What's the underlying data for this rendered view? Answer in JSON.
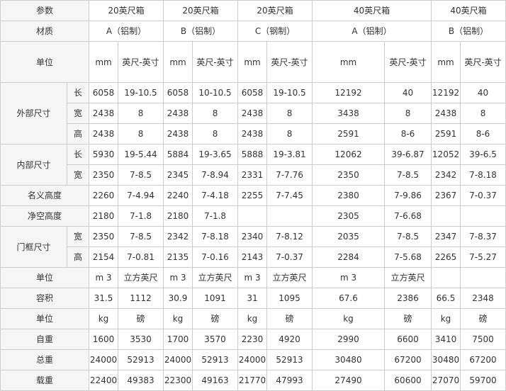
{
  "table": {
    "rows": [
      {
        "key": "param",
        "cells": [
          {
            "text": "参数",
            "cs": 2,
            "lbl": true
          },
          {
            "text": "20英尺箱",
            "cs": 2
          },
          {
            "text": "20英尺箱",
            "cs": 2
          },
          {
            "text": "20英尺箱",
            "cs": 2
          },
          {
            "text": "40英尺箱",
            "cs": 2
          },
          {
            "text": "40英尺箱",
            "cs": 2
          }
        ]
      },
      {
        "key": "material",
        "cells": [
          {
            "text": "材质",
            "cs": 2,
            "lbl": true
          },
          {
            "text": "A（铝制）",
            "cs": 2
          },
          {
            "text": "B（铝制）",
            "cs": 2
          },
          {
            "text": "C（钢制）",
            "cs": 2
          },
          {
            "text": "A（铝制）",
            "cs": 2
          },
          {
            "text": "B（铝制）",
            "cs": 2
          }
        ]
      },
      {
        "key": "unit-1",
        "tall": true,
        "cells": [
          {
            "text": "单位",
            "cs": 2,
            "lbl": true
          },
          {
            "text": "mm"
          },
          {
            "text": "英尺-英寸"
          },
          {
            "text": "mm"
          },
          {
            "text": "英尺-英寸"
          },
          {
            "text": "mm"
          },
          {
            "text": "英尺-英寸"
          },
          {
            "text": "mm"
          },
          {
            "text": "英尺-英寸"
          },
          {
            "text": "mm"
          },
          {
            "text": "英尺-英寸"
          }
        ]
      },
      {
        "key": "ext-length",
        "cells": [
          {
            "text": "外部尺寸",
            "rs": 3,
            "lbl": true
          },
          {
            "text": "长",
            "lbl": true
          },
          {
            "text": "6058"
          },
          {
            "text": "19-10.5"
          },
          {
            "text": "6058"
          },
          {
            "text": "10-10.5"
          },
          {
            "text": "6058"
          },
          {
            "text": "19-10.5"
          },
          {
            "text": "12192"
          },
          {
            "text": "40"
          },
          {
            "text": "12192"
          },
          {
            "text": "40"
          }
        ]
      },
      {
        "key": "ext-width",
        "cells": [
          {
            "text": "宽",
            "lbl": true
          },
          {
            "text": "2438"
          },
          {
            "text": "8"
          },
          {
            "text": "2438"
          },
          {
            "text": "8"
          },
          {
            "text": "2438"
          },
          {
            "text": "8"
          },
          {
            "text": "3438"
          },
          {
            "text": "8"
          },
          {
            "text": "2438"
          },
          {
            "text": "8"
          }
        ]
      },
      {
        "key": "ext-height",
        "cells": [
          {
            "text": "高",
            "lbl": true
          },
          {
            "text": "2438"
          },
          {
            "text": "8"
          },
          {
            "text": "2438"
          },
          {
            "text": "8"
          },
          {
            "text": "2438"
          },
          {
            "text": "8"
          },
          {
            "text": "2591"
          },
          {
            "text": "8-6"
          },
          {
            "text": "2591"
          },
          {
            "text": "8-6"
          }
        ]
      },
      {
        "key": "int-length",
        "cells": [
          {
            "text": "内部尺寸",
            "rs": 2,
            "lbl": true
          },
          {
            "text": "长",
            "lbl": true
          },
          {
            "text": "5930"
          },
          {
            "text": "19-5.44"
          },
          {
            "text": "5884"
          },
          {
            "text": "19-3.65"
          },
          {
            "text": "5888"
          },
          {
            "text": "19-3.81"
          },
          {
            "text": "12062"
          },
          {
            "text": "39-6.87"
          },
          {
            "text": "12052"
          },
          {
            "text": "39-6.5"
          }
        ]
      },
      {
        "key": "int-width",
        "cells": [
          {
            "text": "宽",
            "lbl": true
          },
          {
            "text": "2350"
          },
          {
            "text": "7-8.5"
          },
          {
            "text": "2345"
          },
          {
            "text": "7-8.94"
          },
          {
            "text": "2331"
          },
          {
            "text": "7-7.76"
          },
          {
            "text": "2350"
          },
          {
            "text": "7-8.5"
          },
          {
            "text": "2342"
          },
          {
            "text": "7-8.18"
          }
        ]
      },
      {
        "key": "nominal-height",
        "cells": [
          {
            "text": "名义高度",
            "cs": 2,
            "lbl": true
          },
          {
            "text": "2260"
          },
          {
            "text": "7-4.94"
          },
          {
            "text": "2240"
          },
          {
            "text": "7-4.18"
          },
          {
            "text": "2255"
          },
          {
            "text": "7-7.45"
          },
          {
            "text": "2380"
          },
          {
            "text": "7-9.86"
          },
          {
            "text": "2367"
          },
          {
            "text": "7-0.37"
          }
        ]
      },
      {
        "key": "clear-height",
        "cells": [
          {
            "text": "净空高度",
            "cs": 2,
            "lbl": true
          },
          {
            "text": "2180"
          },
          {
            "text": "7-1.8"
          },
          {
            "text": "2180"
          },
          {
            "text": "7-1.8"
          },
          {
            "text": ""
          },
          {
            "text": ""
          },
          {
            "text": "2305"
          },
          {
            "text": "7-6.68"
          },
          {
            "text": ""
          },
          {
            "text": ""
          }
        ]
      },
      {
        "key": "door-width",
        "cells": [
          {
            "text": "门框尺寸",
            "rs": 2,
            "lbl": true
          },
          {
            "text": "宽",
            "lbl": true
          },
          {
            "text": "2350"
          },
          {
            "text": "7-8.5"
          },
          {
            "text": "2342"
          },
          {
            "text": "7-8.18"
          },
          {
            "text": "2340"
          },
          {
            "text": "7-8.12"
          },
          {
            "text": "2035"
          },
          {
            "text": "7-8.5"
          },
          {
            "text": "2347"
          },
          {
            "text": "7-8.37"
          }
        ]
      },
      {
        "key": "door-height",
        "cells": [
          {
            "text": "高",
            "lbl": true
          },
          {
            "text": "2154"
          },
          {
            "text": "7-0.81"
          },
          {
            "text": "2135"
          },
          {
            "text": "7-0.16"
          },
          {
            "text": "2143"
          },
          {
            "text": "7-0.37"
          },
          {
            "text": "2284"
          },
          {
            "text": "7-5.68"
          },
          {
            "text": "2265"
          },
          {
            "text": "7-5.27"
          }
        ]
      },
      {
        "key": "unit-2",
        "cells": [
          {
            "text": "单位",
            "cs": 2,
            "lbl": true
          },
          {
            "text": "m 3"
          },
          {
            "text": "立方英尺"
          },
          {
            "text": "m 3"
          },
          {
            "text": "立方英尺"
          },
          {
            "text": "m 3"
          },
          {
            "text": "立方英尺"
          },
          {
            "text": "m 3"
          },
          {
            "text": "立方英尺"
          },
          {
            "text": ""
          },
          {
            "text": ""
          }
        ]
      },
      {
        "key": "volume",
        "cells": [
          {
            "text": "容积",
            "cs": 2,
            "lbl": true
          },
          {
            "text": "31.5"
          },
          {
            "text": "1112"
          },
          {
            "text": "30.9"
          },
          {
            "text": "1091"
          },
          {
            "text": "31"
          },
          {
            "text": "1095"
          },
          {
            "text": "67.6"
          },
          {
            "text": "2386"
          },
          {
            "text": "66.5"
          },
          {
            "text": "2348"
          }
        ]
      },
      {
        "key": "unit-3",
        "cells": [
          {
            "text": "单位",
            "cs": 2,
            "lbl": true
          },
          {
            "text": "kg"
          },
          {
            "text": "磅"
          },
          {
            "text": "kg"
          },
          {
            "text": "磅"
          },
          {
            "text": "kg"
          },
          {
            "text": "磅"
          },
          {
            "text": "kg"
          },
          {
            "text": "磅"
          },
          {
            "text": "kg"
          },
          {
            "text": "磅"
          }
        ]
      },
      {
        "key": "tare-weight",
        "cells": [
          {
            "text": "自重",
            "cs": 2,
            "lbl": true
          },
          {
            "text": "1600"
          },
          {
            "text": "3530"
          },
          {
            "text": "1700"
          },
          {
            "text": "3570"
          },
          {
            "text": "2230"
          },
          {
            "text": "4920"
          },
          {
            "text": "2990"
          },
          {
            "text": "6600"
          },
          {
            "text": "3410"
          },
          {
            "text": "7500"
          }
        ]
      },
      {
        "key": "gross-weight",
        "cells": [
          {
            "text": "总重",
            "cs": 2,
            "lbl": true
          },
          {
            "text": "24000"
          },
          {
            "text": "52913"
          },
          {
            "text": "24000"
          },
          {
            "text": "52913"
          },
          {
            "text": "24000"
          },
          {
            "text": "52913"
          },
          {
            "text": "30480"
          },
          {
            "text": "67200"
          },
          {
            "text": "30480"
          },
          {
            "text": "67200"
          }
        ]
      },
      {
        "key": "payload",
        "cells": [
          {
            "text": "载重",
            "cs": 2,
            "lbl": true
          },
          {
            "text": "22400"
          },
          {
            "text": "49383"
          },
          {
            "text": "22300"
          },
          {
            "text": "49163"
          },
          {
            "text": "21770"
          },
          {
            "text": "47993"
          },
          {
            "text": "27490"
          },
          {
            "text": "60600"
          },
          {
            "text": "27070"
          },
          {
            "text": "59700"
          }
        ]
      }
    ]
  }
}
